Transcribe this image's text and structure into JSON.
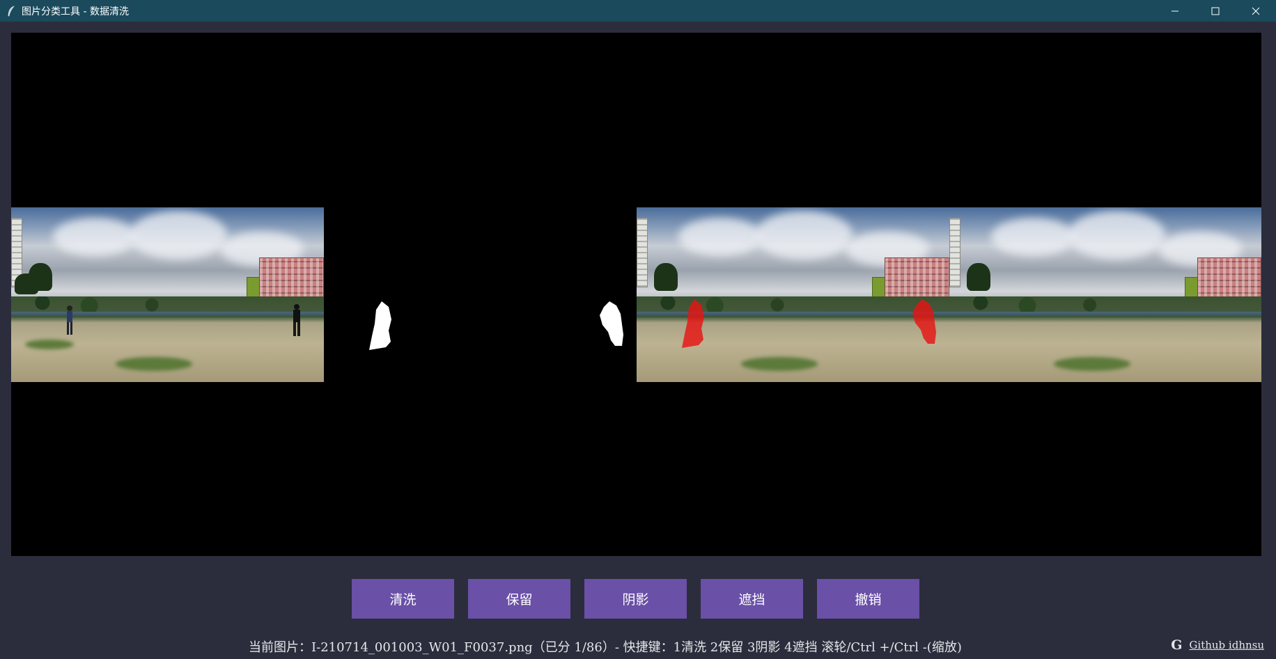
{
  "window": {
    "title": "图片分类工具 - 数据清洗",
    "icon": "feather-icon",
    "controls": [
      "minimize-icon",
      "maximize-icon",
      "close-icon"
    ]
  },
  "canvas": {
    "background": "#000000",
    "panels": [
      "original-photo",
      "mask",
      "overlay-photo",
      "clean-photo"
    ],
    "overlay_color": "#e02020"
  },
  "buttons": {
    "wash": "清洗",
    "keep": "保留",
    "shadow": "阴影",
    "occlude": "遮挡",
    "undo": "撤销"
  },
  "status": {
    "text": "当前图片：I-210714_001003_W01_F0037.png（已分 1/86）- 快捷键：1清洗 2保留 3阴影 4遮挡  滚轮/Ctrl +/Ctrl -(缩放)"
  },
  "footer": {
    "github_icon": "G",
    "github_label": "Github idhnsu"
  },
  "colors": {
    "titlebar": "#1a4a5c",
    "background": "#2b2d3c",
    "button": "#6a50a7"
  }
}
